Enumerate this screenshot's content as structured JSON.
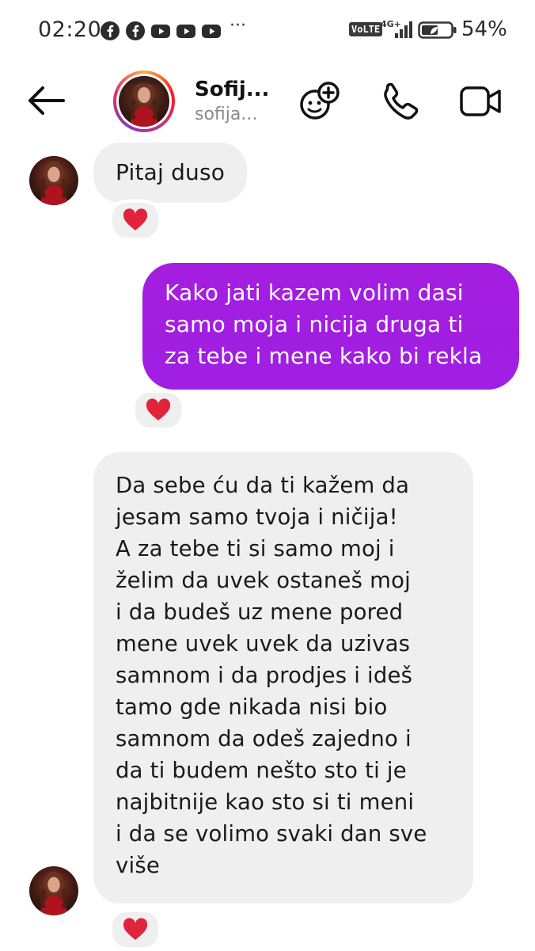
{
  "status_bar": {
    "time": "02:20",
    "notifications": [
      "facebook-icon",
      "facebook-icon",
      "youtube-icon",
      "youtube-icon",
      "youtube-icon"
    ],
    "more": "···",
    "volte": "VoLTE",
    "network": "4G+",
    "battery": "54%"
  },
  "header": {
    "name": "Sofij...",
    "username": "sofija..."
  },
  "messages": [
    {
      "from": "them",
      "text": "Pitaj duso",
      "reaction": "heart"
    },
    {
      "from": "me",
      "text": "Kako jati kazem volim dasi\nsamo moja i nicija druga ti\nza tebe i mene kako bi rekla",
      "reaction": "heart"
    },
    {
      "from": "them",
      "text": "Da sebe ću da ti kažem da\njesam samo tvoja i ničija!\nA za tebe ti si samo moj i\nželim da uvek ostaneš moj\ni da budeš uz mene pored\nmene uvek uvek da uzivas\nsamnom i da prodjes i ideš\ntamo gde nikada nisi bio\nsamnom da odeš zajedno i\nda ti budem nešto sto ti je\nnajbitnije kao sto si ti meni\ni da se volimo svaki dan sve\nviše",
      "reaction": "heart"
    }
  ],
  "colors": {
    "sent_bubble": "#a31fe0",
    "received_bubble": "#efefef",
    "heart": "#e0243c"
  }
}
